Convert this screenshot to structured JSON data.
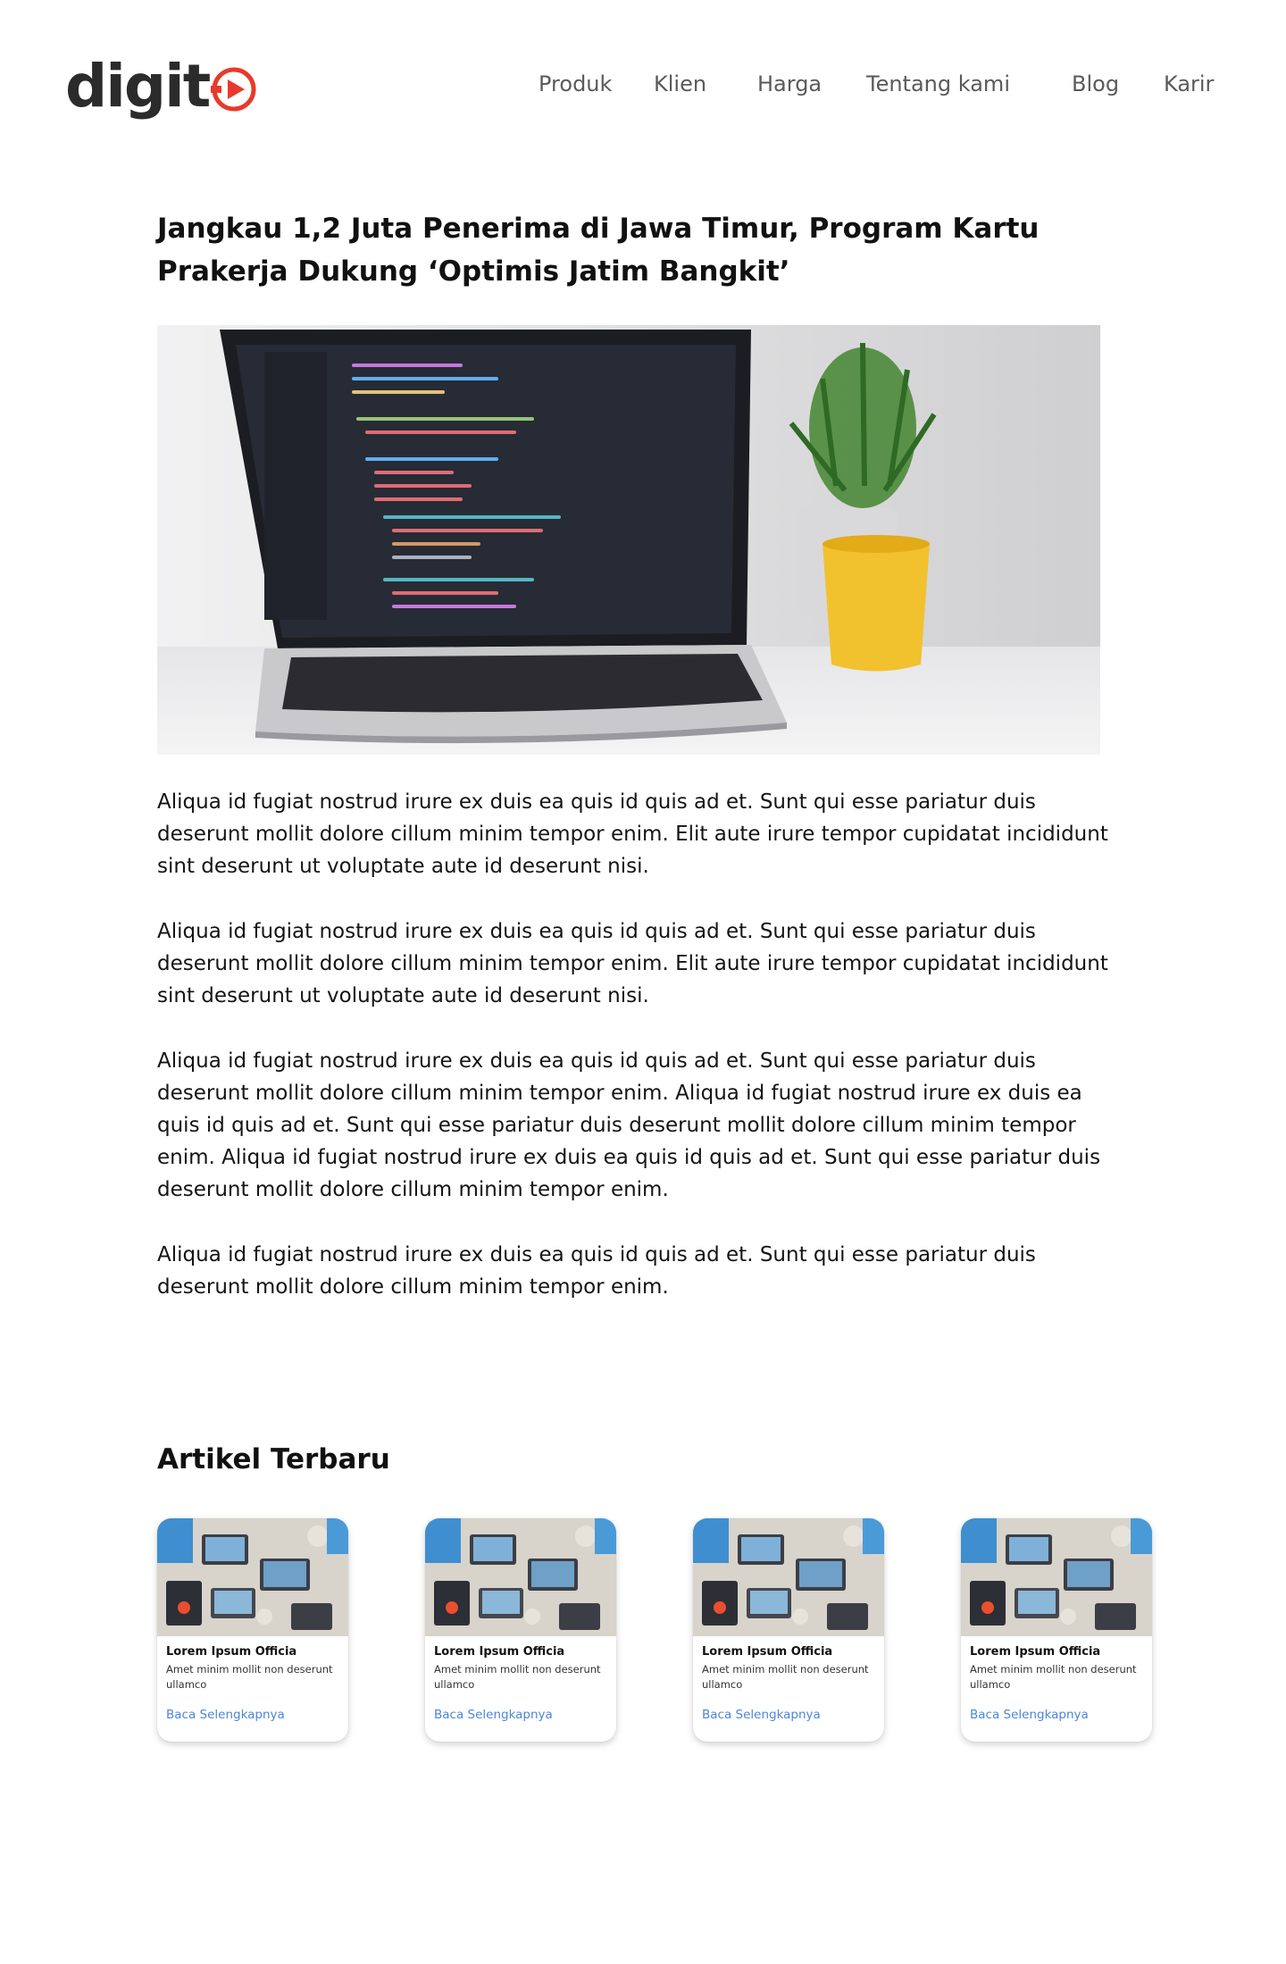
{
  "brand": {
    "logo_text": "digit",
    "accent_color": "#e8392c"
  },
  "nav": {
    "items": [
      {
        "label": "Produk"
      },
      {
        "label": "Klien"
      },
      {
        "label": "Harga"
      },
      {
        "label": "Tentang kami"
      },
      {
        "label": "Blog"
      },
      {
        "label": "Karir"
      }
    ]
  },
  "article": {
    "title": "Jangkau 1,2 Juta Penerima di Jawa Timur, Program Kartu Prakerja Dukung ‘Optimis Jatim Bangkit’",
    "hero_image": "laptop-with-code-and-plant",
    "paragraphs": [
      "Aliqua id fugiat nostrud irure ex duis ea quis id quis ad et. Sunt qui esse pariatur duis deserunt mollit dolore cillum minim tempor enim. Elit aute irure tempor cupidatat incididunt sint deserunt ut voluptate aute id deserunt nisi.",
      "Aliqua id fugiat nostrud irure ex duis ea quis id quis ad et. Sunt qui esse pariatur duis deserunt mollit dolore cillum minim tempor enim. Elit aute irure tempor cupidatat incididunt sint deserunt ut voluptate aute id deserunt nisi.",
      "Aliqua id fugiat nostrud irure ex duis ea quis id quis ad et. Sunt qui esse pariatur duis deserunt mollit dolore cillum minim tempor enim. Aliqua id fugiat nostrud irure ex duis ea quis id quis ad et. Sunt qui esse pariatur duis deserunt mollit dolore cillum minim tempor enim. Aliqua id fugiat nostrud irure ex duis ea quis id quis ad et. Sunt qui esse pariatur duis deserunt mollit dolore cillum minim tempor enim.",
      "Aliqua id fugiat nostrud irure ex duis ea quis id quis ad et. Sunt qui esse pariatur duis deserunt mollit dolore cillum minim tempor enim."
    ]
  },
  "latest": {
    "title": "Artikel Terbaru",
    "cards": [
      {
        "title": "Lorem Ipsum Officia",
        "desc": "Amet minim mollit non deserunt ullamco",
        "link": "Baca Selengkapnya",
        "image": "team-desk-top-view"
      },
      {
        "title": "Lorem Ipsum Officia",
        "desc": "Amet minim mollit non deserunt ullamco",
        "link": "Baca Selengkapnya",
        "image": "team-desk-top-view"
      },
      {
        "title": "Lorem Ipsum Officia",
        "desc": "Amet minim mollit non deserunt ullamco",
        "link": "Baca Selengkapnya",
        "image": "team-desk-top-view"
      },
      {
        "title": "Lorem Ipsum Officia",
        "desc": "Amet minim mollit non deserunt ullamco",
        "link": "Baca Selengkapnya",
        "image": "team-desk-top-view"
      }
    ]
  },
  "colors": {
    "link": "#4b86d8",
    "nav_text": "#5a5a5a",
    "heading": "#111111"
  }
}
